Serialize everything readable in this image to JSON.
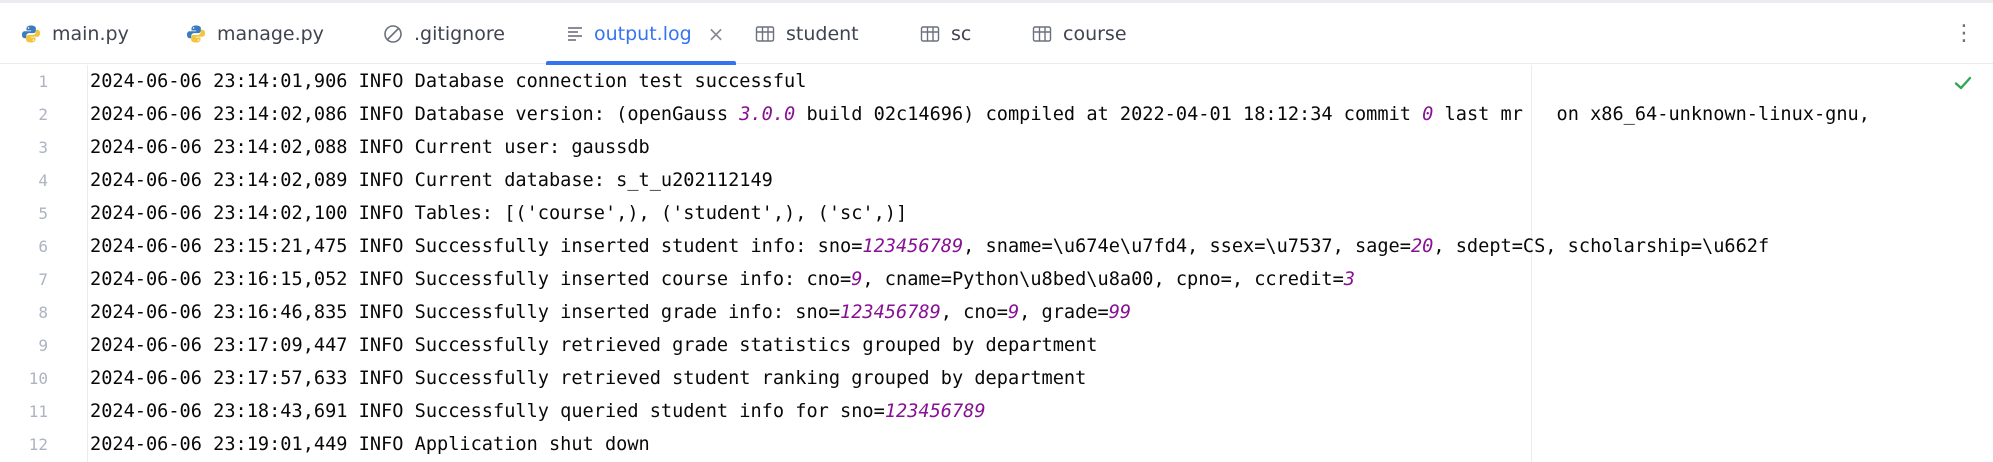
{
  "tabs": [
    {
      "label": "main.py",
      "icon": "python-icon"
    },
    {
      "label": "manage.py",
      "icon": "python-icon"
    },
    {
      "label": ".gitignore",
      "icon": "ignore-icon"
    },
    {
      "label": "output.log",
      "icon": "log-file-icon",
      "active": true,
      "close": "×"
    },
    {
      "label": "student",
      "icon": "table-icon"
    },
    {
      "label": "sc",
      "icon": "table-icon"
    },
    {
      "label": "course",
      "icon": "table-icon"
    }
  ],
  "kebab": "⋮",
  "colors": {
    "accent": "#3574f0",
    "number": "#871094",
    "line_number": "#aeb3c2",
    "check": "#2fa84f"
  },
  "lines": [
    {
      "n": "1",
      "parts": [
        {
          "t": "2024-06-06 23:14:01,906 INFO Database connection test successful"
        }
      ]
    },
    {
      "n": "2",
      "parts": [
        {
          "t": "2024-06-06 23:14:02,086 INFO Database version: (openGauss "
        },
        {
          "t": "3.0.0",
          "num": true
        },
        {
          "t": " build 02c14696) compiled at 2022-04-01 18:12:34 commit "
        },
        {
          "t": "0",
          "num": true
        },
        {
          "t": " last mr   on x86_64-unknown-linux-gnu,"
        }
      ]
    },
    {
      "n": "3",
      "parts": [
        {
          "t": "2024-06-06 23:14:02,088 INFO Current user: gaussdb"
        }
      ]
    },
    {
      "n": "4",
      "parts": [
        {
          "t": "2024-06-06 23:14:02,089 INFO Current database: s_t_u202112149"
        }
      ]
    },
    {
      "n": "5",
      "parts": [
        {
          "t": "2024-06-06 23:14:02,100 INFO Tables: [('course',), ('student',), ('sc',)]"
        }
      ]
    },
    {
      "n": "6",
      "parts": [
        {
          "t": "2024-06-06 23:15:21,475 INFO Successfully inserted student info: sno="
        },
        {
          "t": "123456789",
          "num": true
        },
        {
          "t": ", sname=\\u674e\\u7fd4, ssex=\\u7537, sage="
        },
        {
          "t": "20",
          "num": true
        },
        {
          "t": ", sdept=CS, scholarship=\\u662f"
        }
      ]
    },
    {
      "n": "7",
      "parts": [
        {
          "t": "2024-06-06 23:16:15,052 INFO Successfully inserted course info: cno="
        },
        {
          "t": "9",
          "num": true
        },
        {
          "t": ", cname=Python\\u8bed\\u8a00, cpno=, ccredit="
        },
        {
          "t": "3",
          "num": true
        }
      ]
    },
    {
      "n": "8",
      "parts": [
        {
          "t": "2024-06-06 23:16:46,835 INFO Successfully inserted grade info: sno="
        },
        {
          "t": "123456789",
          "num": true
        },
        {
          "t": ", cno="
        },
        {
          "t": "9",
          "num": true
        },
        {
          "t": ", grade="
        },
        {
          "t": "99",
          "num": true
        }
      ]
    },
    {
      "n": "9",
      "parts": [
        {
          "t": "2024-06-06 23:17:09,447 INFO Successfully retrieved grade statistics grouped by department"
        }
      ]
    },
    {
      "n": "10",
      "parts": [
        {
          "t": "2024-06-06 23:17:57,633 INFO Successfully retrieved student ranking grouped by department"
        }
      ]
    },
    {
      "n": "11",
      "parts": [
        {
          "t": "2024-06-06 23:18:43,691 INFO Successfully queried student info for sno="
        },
        {
          "t": "123456789",
          "num": true
        }
      ]
    },
    {
      "n": "12",
      "parts": [
        {
          "t": "2024-06-06 23:19:01,449 INFO Application shut down"
        }
      ]
    }
  ]
}
